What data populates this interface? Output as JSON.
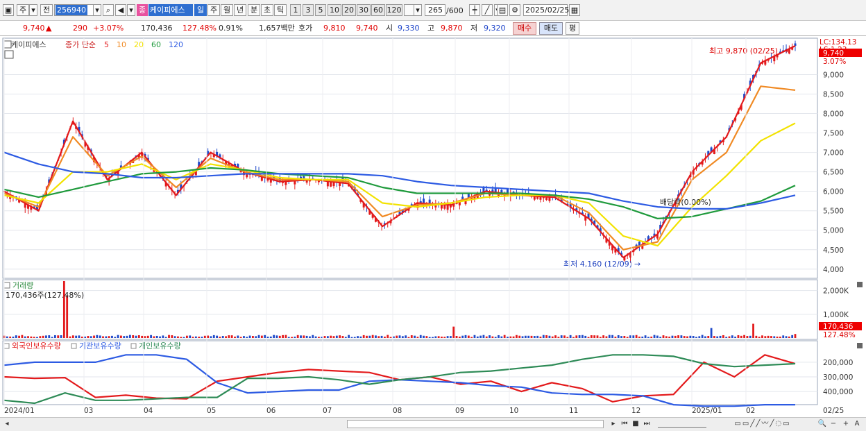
{
  "toolbar": {
    "market_label": "주",
    "jeon_label": "전",
    "stock_code": "256940",
    "dot_label": "·",
    "jong_label": "종",
    "stock_name": "케이피에스",
    "periods": [
      "일",
      "주",
      "월",
      "년",
      "분",
      "초",
      "틱"
    ],
    "intervals": [
      "1",
      "3",
      "5",
      "10",
      "20",
      "30",
      "60",
      "120"
    ],
    "count_value": "265",
    "count_total": "/600",
    "date_value": "2025/02/25"
  },
  "quote": {
    "price": "9,740",
    "up_arrow": "▲",
    "change": "290",
    "change_pct": "+3.07%",
    "volume": "170,436",
    "volume_pct": "127.48%",
    "turnover": "0.91%",
    "amount": "1,657백만",
    "bid_label": "호가",
    "bid1": "9,810",
    "bid2": "9,740",
    "open_label": "시",
    "open": "9,330",
    "high_label": "고",
    "high": "9,870",
    "low_label": "저",
    "low": "9,320",
    "buy_label": "매수",
    "sell_label": "매도",
    "eval_label": "평"
  },
  "price_panel": {
    "stock_tag": "케이피에스",
    "legend_prefix": "종가 단순",
    "ma_labels": [
      "5",
      "10",
      "20",
      "60",
      "120"
    ],
    "ma_colors": [
      "#e31a1c",
      "#f08a24",
      "#f2e200",
      "#1f9a3c",
      "#2d5be3"
    ],
    "lc_label": "LC:134.13",
    "lc_sub": "LS:1.23",
    "current_price_tag": "9,740",
    "current_pct": "3.07%",
    "high_annotation": "최고 9,870 (02/25)",
    "low_annotation": "최저 4,160 (12/09)",
    "dividend_annotation": "배당락(0.00%)",
    "y_ticks": [
      "9,000",
      "8,500",
      "8,000",
      "7,500",
      "7,000",
      "6,500",
      "6,000",
      "5,500",
      "5,000",
      "4,500",
      "4,000"
    ]
  },
  "volume_panel": {
    "title": "거래량",
    "value_label": "170,436주(127.48%)",
    "y_ticks": [
      "2,000K",
      "1,000K"
    ],
    "current_tag": "170,436",
    "current_pct": "127.48%"
  },
  "holdings_panel": {
    "legend": [
      "외국인보유수량",
      "기관보유수량",
      "개인보유수량"
    ],
    "legend_colors": [
      "#e31a1c",
      "#2d5be3",
      "#2e8b57"
    ],
    "y_ticks": [
      "400,000",
      "300,000",
      "200,000"
    ]
  },
  "x_axis": {
    "labels": [
      "2024/01",
      "03",
      "04",
      "05",
      "06",
      "07",
      "08",
      "09",
      "10",
      "11",
      "12",
      "2025/01",
      "02",
      "02/25"
    ]
  },
  "status_bar": {
    "prev_icon": "◂",
    "next_icon": "▸",
    "first_icon": "⏮",
    "stop_icon": "■",
    "last_icon": "⏭",
    "zoom_icon": "🔍",
    "minus_icon": "−",
    "plus_icon": "+",
    "text_icon": "A"
  },
  "chart_data": [
    {
      "type": "line",
      "title": "케이피에스",
      "description_series": "종가 단순 이동평균 5,10,20,60,120",
      "x": [
        "2024/01",
        "03",
        "04",
        "05",
        "06",
        "07",
        "08",
        "09",
        "10",
        "11",
        "12",
        "2025/01",
        "02",
        "02/25"
      ],
      "series": [
        {
          "name": "5",
          "values": [
            6000,
            5500,
            7800,
            6300,
            7000,
            5900,
            7000,
            6500,
            6250,
            6300,
            6200,
            5100,
            5700,
            5650,
            6000,
            5900,
            5850,
            5300,
            4300,
            4900,
            6500,
            7400,
            9300,
            9740
          ]
        },
        {
          "name": "10",
          "values": [
            5950,
            5600,
            7400,
            6400,
            6900,
            6100,
            6850,
            6500,
            6300,
            6300,
            6250,
            5350,
            5650,
            5700,
            5950,
            5900,
            5900,
            5450,
            4500,
            4700,
            6300,
            7000,
            8700,
            8600
          ]
        },
        {
          "name": "20",
          "values": [
            5900,
            5700,
            6500,
            6500,
            6700,
            6300,
            6700,
            6550,
            6350,
            6300,
            6300,
            5700,
            5600,
            5700,
            5850,
            5900,
            5900,
            5700,
            4850,
            4600,
            5600,
            6400,
            7300,
            7750
          ]
        },
        {
          "name": "60",
          "values": [
            6050,
            5850,
            6050,
            6250,
            6450,
            6500,
            6600,
            6550,
            6450,
            6400,
            6350,
            6100,
            5950,
            5950,
            5950,
            5950,
            5900,
            5800,
            5600,
            5300,
            5350,
            5550,
            5750,
            6150
          ]
        },
        {
          "name": "120",
          "values": [
            7000,
            6700,
            6500,
            6450,
            6350,
            6350,
            6400,
            6450,
            6450,
            6450,
            6450,
            6400,
            6250,
            6150,
            6100,
            6050,
            6000,
            5950,
            5750,
            5600,
            5550,
            5550,
            5700,
            5900
          ]
        }
      ],
      "ylim": [
        3800,
        9900
      ],
      "y_ticks": [
        4000,
        4500,
        5000,
        5500,
        6000,
        6500,
        7000,
        7500,
        8000,
        8500,
        9000
      ],
      "annotations": [
        "최고 9,870 (02/25)",
        "최저 4,160 (12/09)",
        "배당락(0.00%)"
      ]
    },
    {
      "type": "bar",
      "title": "거래량",
      "ylim": [
        0,
        2400000
      ],
      "y_ticks": [
        "1,000K",
        "2,000K"
      ],
      "notable_values": {
        "2024/02 spike": 2400000,
        "last": 170436
      }
    },
    {
      "type": "line",
      "series": [
        {
          "name": "외국인보유수량",
          "values": [
            300000,
            290000,
            295000,
            160000,
            175000,
            155000,
            150000,
            270000,
            300000,
            330000,
            350000,
            340000,
            330000,
            280000,
            300000,
            250000,
            270000,
            200000,
            260000,
            220000,
            130000,
            170000,
            180000,
            400000,
            300000,
            450000,
            390000
          ]
        },
        {
          "name": "기관보유수량",
          "values": [
            380000,
            400000,
            400000,
            400000,
            450000,
            450000,
            420000,
            260000,
            190000,
            200000,
            210000,
            210000,
            270000,
            280000,
            270000,
            260000,
            240000,
            230000,
            190000,
            180000,
            180000,
            170000,
            110000,
            100000,
            100000,
            110000,
            110000
          ]
        },
        {
          "name": "개인보유수량",
          "values": [
            140000,
            120000,
            190000,
            140000,
            140000,
            150000,
            160000,
            160000,
            290000,
            290000,
            300000,
            280000,
            250000,
            280000,
            300000,
            330000,
            340000,
            360000,
            380000,
            420000,
            450000,
            450000,
            440000,
            390000,
            370000,
            380000,
            390000
          ]
        }
      ],
      "ylim": [
        120000,
        480000
      ],
      "y_ticks": [
        200000,
        300000,
        400000
      ]
    }
  ]
}
